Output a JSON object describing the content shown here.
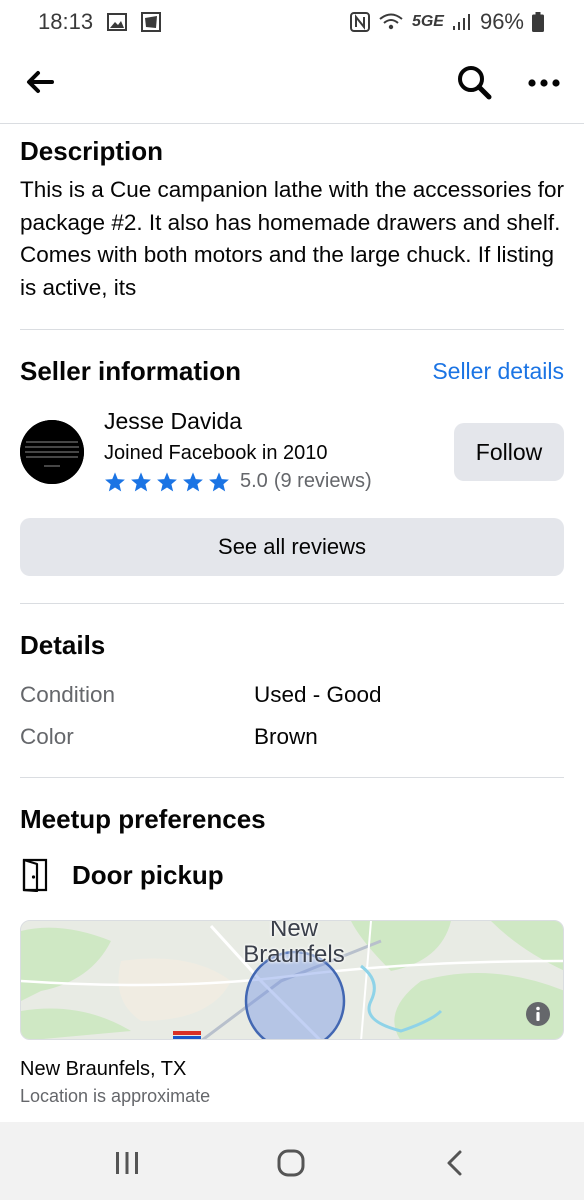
{
  "status_bar": {
    "time": "18:13",
    "network": "5GE",
    "battery": "96%"
  },
  "app_bar": {
    "back_icon": "arrow-left-icon",
    "search_icon": "search-icon",
    "more_icon": "more-horizontal-icon"
  },
  "description": {
    "title": "Description",
    "text": "This is a Cue campanion lathe with the accessories for package #2. It also has homemade drawers and shelf. Comes with both motors and the large chuck. If listing is active, its"
  },
  "seller": {
    "title": "Seller information",
    "details_link": "Seller details",
    "name": "Jesse Davida",
    "joined": "Joined Facebook in 2010",
    "stars": 5,
    "rating": "5.0",
    "reviews_count": "(9 reviews)",
    "follow_label": "Follow",
    "see_reviews_label": "See all reviews",
    "accent_color": "#1b74e4"
  },
  "details": {
    "title": "Details",
    "rows": [
      {
        "label": "Condition",
        "value": "Used - Good"
      },
      {
        "label": "Color",
        "value": "Brown"
      }
    ]
  },
  "meetup": {
    "title": "Meetup preferences",
    "pickup_label": "Door pickup",
    "map_label_line1": "New",
    "map_label_line2": "Braunfels",
    "location": "New Braunfels, TX",
    "location_note": "Location is approximate"
  }
}
